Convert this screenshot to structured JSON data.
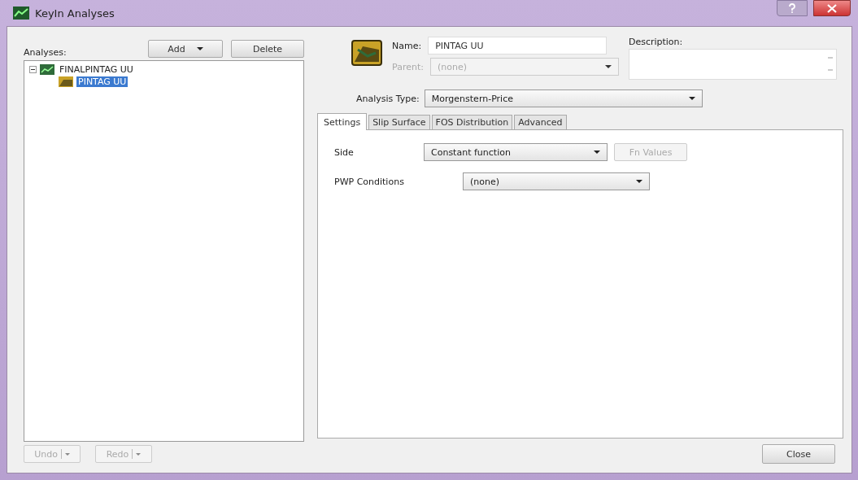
{
  "window": {
    "title": "KeyIn Analyses"
  },
  "analyses_label": "Analyses:",
  "list_buttons": [
    {
      "label": "Add",
      "dropdown": true
    },
    {
      "label": "Delete",
      "dropdown": false
    }
  ],
  "tree": [
    {
      "label": "FINALPINTAG UU",
      "selected": false,
      "expanded": true,
      "children": [
        {
          "label": "PINTAG UU",
          "selected": true
        }
      ]
    }
  ],
  "name": {
    "label": "Name:",
    "value": "PINTAG UU"
  },
  "parent": {
    "label": "Parent:",
    "value": "(none)",
    "disabled": true
  },
  "description": {
    "label": "Description:"
  },
  "analysis_type": {
    "label": "Analysis Type:",
    "value": "Morgenstern-Price"
  },
  "tabs": [
    {
      "label": "Settings",
      "selected": true
    },
    {
      "label": "Slip Surface",
      "selected": false
    },
    {
      "label": "FOS Distribution",
      "selected": false
    },
    {
      "label": "Advanced",
      "selected": false
    }
  ],
  "settings": [
    {
      "label": "Side",
      "value": "Constant function",
      "button": {
        "label": "Fn Values",
        "disabled": true
      }
    },
    {
      "label": "PWP Conditions",
      "value": "(none)"
    }
  ],
  "footer_buttons": [
    {
      "label": "Undo",
      "disabled": true
    },
    {
      "label": "Redo",
      "disabled": true
    }
  ],
  "close_button": {
    "label": "Close"
  }
}
